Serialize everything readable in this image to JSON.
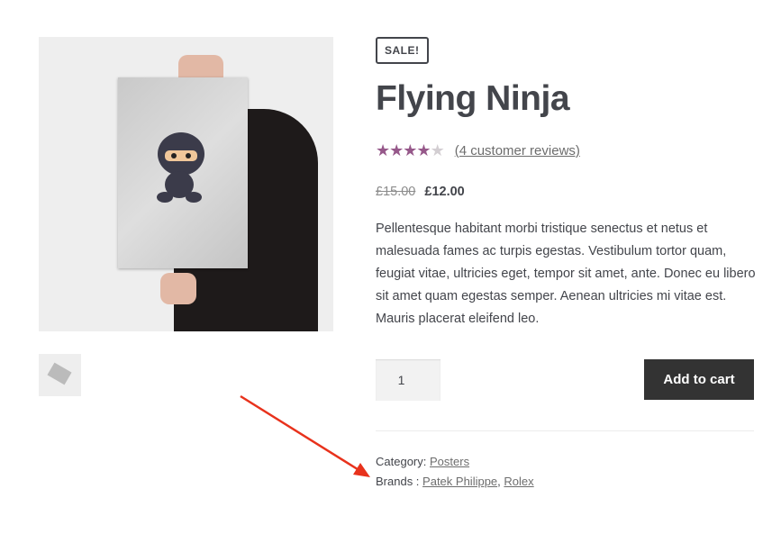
{
  "product": {
    "badge": "SALE!",
    "title": "Flying Ninja",
    "rating": 4,
    "rating_max": 5,
    "reviews_link": "(4 customer reviews)",
    "old_price": "£15.00",
    "price": "£12.00",
    "description": "Pellentesque habitant morbi tristique senectus et netus et malesuada fames ac turpis egestas. Vestibulum tortor quam, feugiat vitae, ultricies eget, tempor sit amet, ante. Donec eu libero sit amet quam egestas semper. Aenean ultricies mi vitae est. Mauris placerat eleifend leo.",
    "quantity": "1",
    "add_to_cart": "Add to cart"
  },
  "meta": {
    "category_label": "Category:",
    "category": "Posters",
    "brands_label": "Brands :",
    "brands": [
      "Patek Philippe",
      "Rolex"
    ],
    "separator": ","
  },
  "colors": {
    "star": "#96588a",
    "arrow": "#e8321c",
    "button": "#333333"
  }
}
